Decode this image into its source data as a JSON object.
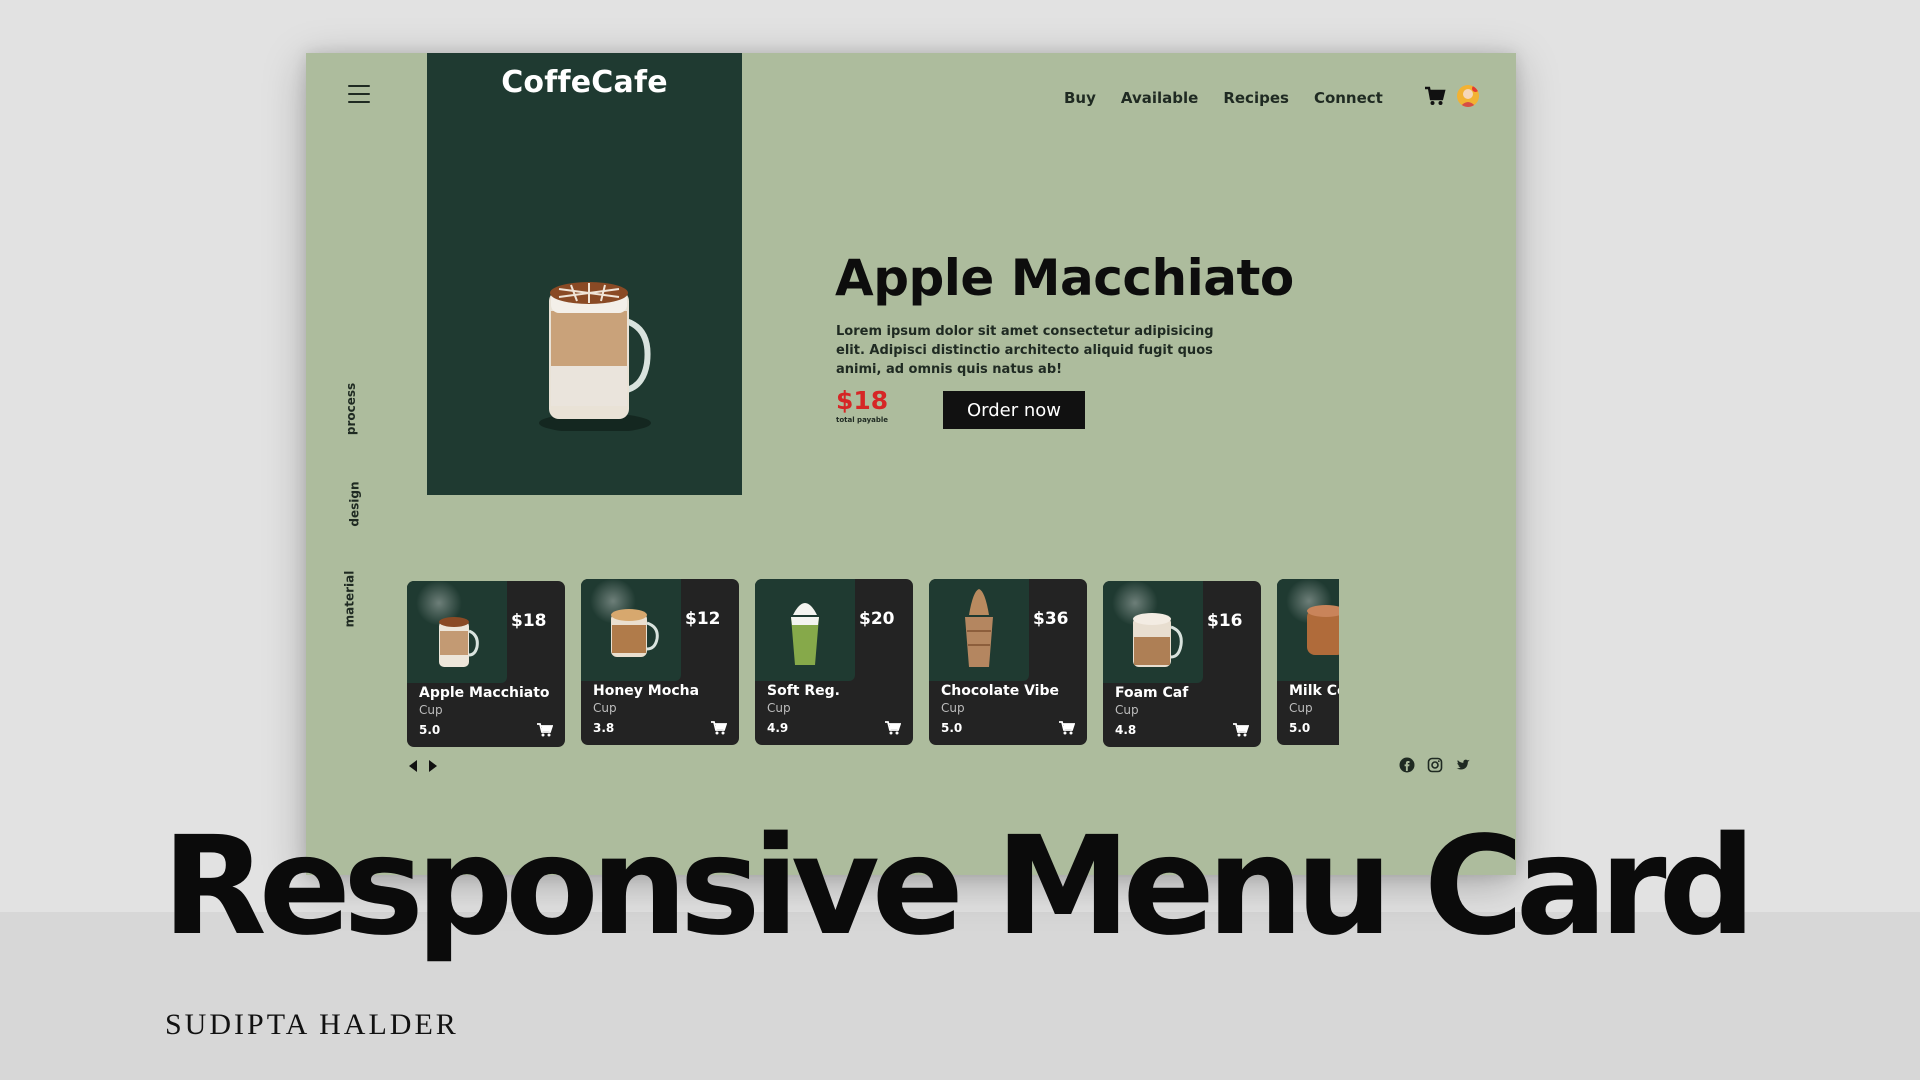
{
  "app": {
    "title": "CoffeCafe"
  },
  "nav": [
    "Buy",
    "Available",
    "Recipes",
    "Connect"
  ],
  "side_nav": [
    "process",
    "design",
    "material"
  ],
  "hero": {
    "title": "Apple Macchiato",
    "description": "Lorem ipsum dolor sit amet consectetur adipisicing elit. Adipisci distinctio architecto aliquid fugit quos animi, ad omnis quis natus ab!",
    "price": "$18",
    "price_note": "total payable",
    "cta": "Order now"
  },
  "products": [
    {
      "name": "Apple Macchiato",
      "price": "$18",
      "unit": "Cup",
      "rating": "5.0",
      "drink": "macchiato"
    },
    {
      "name": "Honey Mocha",
      "price": "$12",
      "unit": "Cup",
      "rating": "3.8",
      "drink": "mocha"
    },
    {
      "name": "Soft Reg.",
      "price": "$20",
      "unit": "Cup",
      "rating": "4.9",
      "drink": "matcha"
    },
    {
      "name": "Chocolate Vibe",
      "price": "$36",
      "unit": "Cup",
      "rating": "5.0",
      "drink": "frappe"
    },
    {
      "name": "Foam Caf",
      "price": "$16",
      "unit": "Cup",
      "rating": "4.8",
      "drink": "latte"
    },
    {
      "name": "Milk Co",
      "price": "",
      "unit": "Cup",
      "rating": "5.0",
      "drink": "milk"
    }
  ],
  "icons": {
    "menu": "hamburger-icon",
    "cart": "cart-icon",
    "avatar": "avatar-icon",
    "prev": "arrow-left-icon",
    "next": "arrow-right-icon",
    "social": [
      "facebook-icon",
      "instagram-icon",
      "twitter-icon"
    ]
  },
  "colors": {
    "background": "#adbc9d",
    "panel": "#1f3a31",
    "card": "#232323",
    "accent_price": "#d62626",
    "button": "#111111"
  },
  "caption": {
    "title": "Responsive Menu Card",
    "author": "SUDIPTA HALDER"
  }
}
